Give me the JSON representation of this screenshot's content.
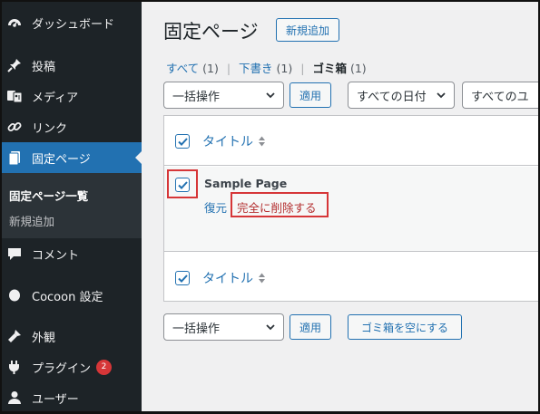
{
  "sidebar": {
    "items": [
      {
        "label": "ダッシュボード",
        "icon": "dashboard-icon"
      },
      {
        "label": "投稿",
        "icon": "pin-icon"
      },
      {
        "label": "メディア",
        "icon": "media-icon"
      },
      {
        "label": "リンク",
        "icon": "link-icon"
      },
      {
        "label": "固定ページ",
        "icon": "pages-icon"
      },
      {
        "label": "コメント",
        "icon": "comment-icon"
      },
      {
        "label": "Cocoon 設定",
        "icon": "cocoon-icon"
      },
      {
        "label": "外観",
        "icon": "appearance-icon"
      },
      {
        "label": "プラグイン",
        "icon": "plugin-icon",
        "badge": "2"
      },
      {
        "label": "ユーザー",
        "icon": "user-icon"
      }
    ],
    "submenu": [
      "固定ページ一覧",
      "新規追加"
    ]
  },
  "header": {
    "title": "固定ページ",
    "add_new": "新規追加"
  },
  "filters": {
    "all": "すべて",
    "all_count": "(1)",
    "draft": "下書き",
    "draft_count": "(1)",
    "trash": "ゴミ箱",
    "trash_count": "(1)",
    "separator": "|"
  },
  "toolbar_top": {
    "bulk_action": "一括操作",
    "apply": "適用",
    "date_filter": "すべての日付",
    "category_filter": "すべてのユ"
  },
  "table": {
    "column_title": "タイトル",
    "rows": [
      {
        "title": "Sample Page",
        "restore": "復元",
        "delete_permanently": "完全に削除する"
      }
    ]
  },
  "toolbar_bottom": {
    "bulk_action": "一括操作",
    "apply": "適用",
    "empty_trash": "ゴミ箱を空にする"
  },
  "colors": {
    "sidebar_bg": "#1d2327",
    "accent": "#2271b1",
    "highlight_red": "#d63638"
  }
}
